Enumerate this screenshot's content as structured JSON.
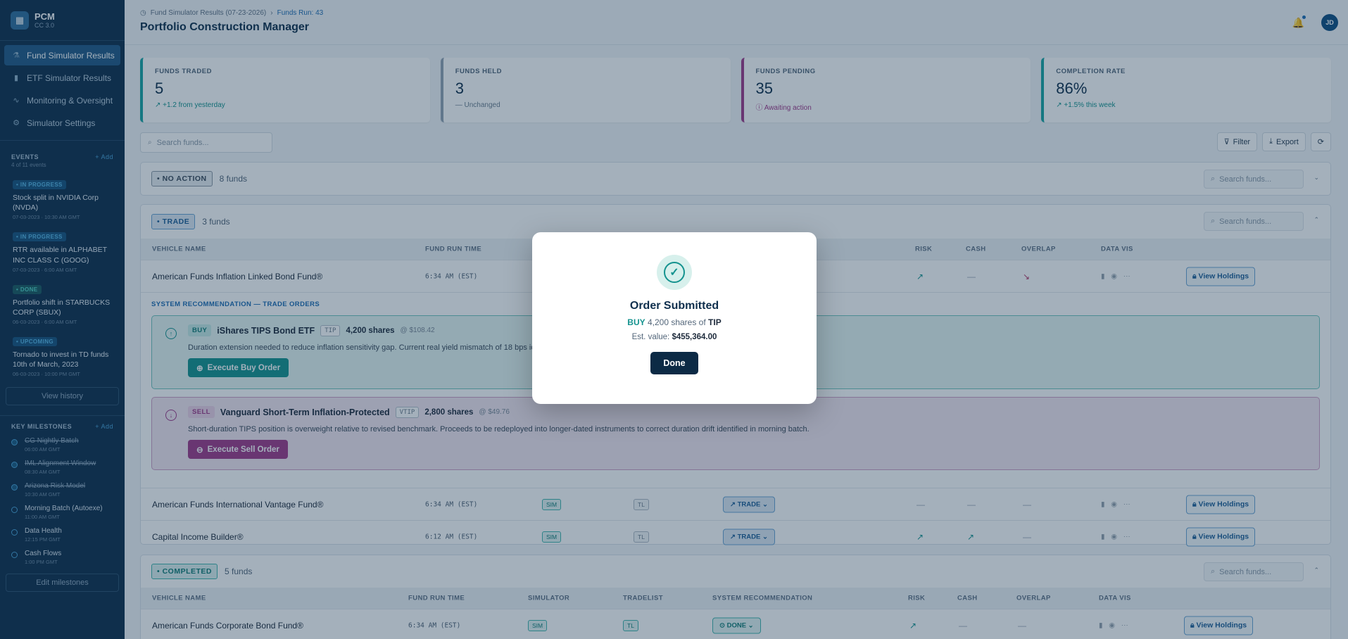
{
  "brand": {
    "name": "PCM",
    "version": "CC 3.0"
  },
  "nav": [
    {
      "label": "Fund Simulator Results",
      "icon": "flask-icon"
    },
    {
      "label": "ETF Simulator Results",
      "icon": "bar-chart-icon"
    },
    {
      "label": "Monitoring & Oversight",
      "icon": "activity-icon"
    },
    {
      "label": "Simulator Settings",
      "icon": "gear-icon"
    }
  ],
  "events": {
    "title": "EVENTS",
    "subtitle": "4 of 11 events",
    "add": "+ Add",
    "items": [
      {
        "badge": "• IN PROGRESS",
        "title": "Stock split in NVIDIA Corp (NVDA)",
        "time": "07-03-2023 · 10:30 AM GMT"
      },
      {
        "badge": "• IN PROGRESS",
        "title": "RTR available in ALPHABET INC CLASS C (GOOG)",
        "time": "07-03-2023 · 6:00 AM GMT"
      },
      {
        "badge": "• DONE",
        "title": "Portfolio shift in STARBUCKS CORP (SBUX)",
        "time": "06-03-2023 · 6:00 AM GMT"
      },
      {
        "badge": "• UPCOMING",
        "title": "Tornado to invest in TD funds 10th of March, 2023",
        "time": "06-03-2023 · 10:00 PM GMT"
      }
    ],
    "view_history": "View history"
  },
  "milestones": {
    "title": "KEY MILESTONES",
    "add": "+ Add",
    "items": [
      {
        "title": "CG Nightly Batch",
        "time": "06:00 AM GMT"
      },
      {
        "title": "IML Alignment Window",
        "time": "08:30 AM GMT"
      },
      {
        "title": "Arizona Risk Model",
        "time": "10:30 AM GMT"
      },
      {
        "title": "Morning Batch (Autoexe)",
        "time": "11:00 AM GMT"
      },
      {
        "title": "Data Health",
        "time": "12:15 PM GMT"
      },
      {
        "title": "Cash Flows",
        "time": "1:00 PM GMT"
      }
    ],
    "edit": "Edit milestones"
  },
  "header": {
    "breadcrumb": "Fund Simulator Results (07-23-2026)",
    "breadcrumb_current": "Funds Run: 43",
    "title": "Portfolio Construction Manager",
    "avatar": "JD"
  },
  "kpis": [
    {
      "label": "FUNDS TRADED",
      "value": "5",
      "delta": "↗ +1.2 from yesterday"
    },
    {
      "label": "FUNDS HELD",
      "value": "3",
      "delta": "— Unchanged"
    },
    {
      "label": "FUNDS PENDING",
      "value": "35",
      "delta": "ⓘ Awaiting action"
    },
    {
      "label": "COMPLETION RATE",
      "value": "86%",
      "delta": "↗ +1.5% this week"
    }
  ],
  "toolbar": {
    "search_placeholder": "Search funds...",
    "filter": "Filter",
    "export": "Export"
  },
  "groups": {
    "no_action": {
      "chip": "• NO ACTION",
      "count": "8 funds",
      "search": "Search funds..."
    },
    "trade": {
      "chip": "• TRADE",
      "count": "3 funds",
      "search": "Search funds..."
    },
    "completed": {
      "chip": "• COMPLETED",
      "count": "5 funds",
      "search": "Search funds..."
    }
  },
  "columns": {
    "vehicle": "VEHICLE NAME",
    "run_time": "FUND RUN TIME",
    "simulator": "SIMULATOR",
    "tradelist": "TRADELIST",
    "recommendation": "SYSTEM RECOMMENDATION",
    "risk": "RISK",
    "cash": "CASH",
    "overlap": "OVERLAP",
    "data_vis": "DATA VIS"
  },
  "trade_rows": [
    {
      "name": "American Funds Inflation Linked Bond Fund®",
      "time": "6:34 AM (EST)",
      "risk": "↗",
      "cash": "—",
      "overlap": "↘"
    },
    {
      "name": "American Funds International Vantage Fund®",
      "time": "6:34 AM (EST)",
      "sim": "SIM",
      "tl": "TL",
      "rec": "↗ TRADE ⌄",
      "risk": "—",
      "cash": "—",
      "overlap": "—"
    },
    {
      "name": "Capital Income Builder®",
      "time": "6:12 AM (EST)",
      "sim": "SIM",
      "tl": "TL",
      "rec": "↗ TRADE ⌄",
      "risk": "↗",
      "cash": "↗",
      "overlap": "—"
    }
  ],
  "completed_rows": [
    {
      "name": "American Funds Corporate Bond Fund®",
      "time": "6:34 AM (EST)",
      "sim": "SIM",
      "tl": "TL",
      "rec": "⊙ DONE ⌄",
      "risk": "↗",
      "cash": "—",
      "overlap": "—"
    }
  ],
  "view_holdings": "View Holdings",
  "sysrec": {
    "title": "SYSTEM RECOMMENDATION — TRADE ORDERS",
    "buy": {
      "action": "BUY",
      "name": "iShares TIPS Bond ETF",
      "ticker": "TIP",
      "shares": "4,200 shares",
      "price": "@ $108.42",
      "desc": "Duration extension needed to reduce inflation sensitivity gap. Current real yield mismatch of 18 bps identified by the overnight risk model and validated against the optimization engine.",
      "button": "Execute Buy Order"
    },
    "sell": {
      "action": "SELL",
      "name": "Vanguard Short-Term Inflation-Protected",
      "ticker": "VTIP",
      "shares": "2,800 shares",
      "price": "@ $49.76",
      "desc": "Short-duration TIPS position is overweight relative to revised benchmark. Proceeds to be redeployed into longer-dated instruments to correct duration drift identified in morning batch.",
      "button": "Execute Sell Order"
    }
  },
  "modal": {
    "title": "Order Submitted",
    "action": "BUY",
    "mid": "4,200 shares of",
    "ticker": "TIP",
    "value_label": "Est. value:",
    "value": "$455,364.00",
    "done": "Done"
  }
}
